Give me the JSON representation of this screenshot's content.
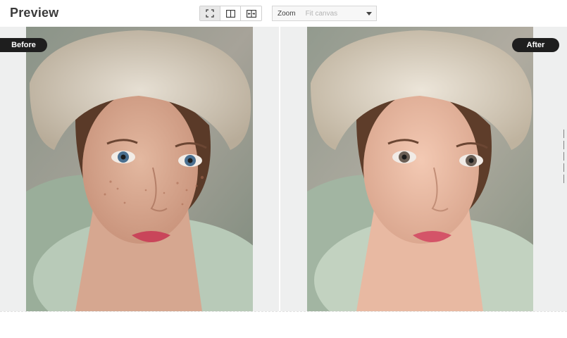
{
  "header": {
    "title": "Preview"
  },
  "view_modes": [
    {
      "icon": "fullscreen-icon",
      "active": true
    },
    {
      "icon": "split-view-icon",
      "active": false
    },
    {
      "icon": "slider-compare-icon",
      "active": false
    }
  ],
  "zoom": {
    "label": "Zoom",
    "value": "Fit canvas"
  },
  "compare": {
    "before_label": "Before",
    "after_label": "After"
  }
}
